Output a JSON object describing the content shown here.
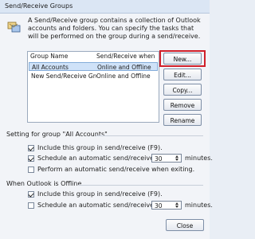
{
  "window": {
    "title": "Send/Receive Groups"
  },
  "description": "A Send/Receive group contains a collection of Outlook accounts and folders. You can specify the tasks that will be performed on the group during a send/receive.",
  "list": {
    "columns": [
      "Group Name",
      "Send/Receive when"
    ],
    "rows": [
      {
        "name": "All Accounts",
        "when": "Online and Offline",
        "selected": true
      },
      {
        "name": "New Send/Receive Group...",
        "when": "Online and Offline",
        "selected": false
      }
    ]
  },
  "buttons": {
    "new": "New...",
    "edit": "Edit...",
    "copy": "Copy...",
    "remove": "Remove",
    "rename": "Rename",
    "close": "Close"
  },
  "setting_group": {
    "title": "Setting for group \"All Accounts\"",
    "include_label": "Include this group in send/receive (F9).",
    "include_checked": true,
    "schedule_label": "Schedule an automatic send/receive every",
    "schedule_checked": true,
    "schedule_value": "30",
    "minutes_label": "minutes.",
    "exit_label": "Perform an automatic send/receive when exiting.",
    "exit_checked": false
  },
  "offline_group": {
    "title": "When Outlook is Offline",
    "include_label": "Include this group in send/receive (F9).",
    "include_checked": true,
    "schedule_label": "Schedule an automatic send/receive every",
    "schedule_checked": false,
    "schedule_value": "30",
    "minutes_label": "minutes."
  },
  "icons": {
    "group_icon": "send-receive-group-icon",
    "spin_up": "spin-up-icon",
    "spin_down": "spin-down-icon"
  },
  "colors": {
    "highlight_border": "#d0202a",
    "selection": "#cfe2f8"
  }
}
